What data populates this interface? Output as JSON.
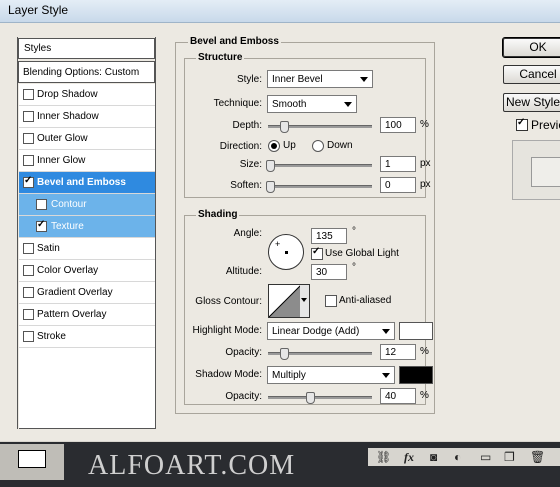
{
  "window": {
    "title": "Layer Style"
  },
  "styles_panel": {
    "header": "Styles",
    "blending": "Blending Options: Custom",
    "items": [
      {
        "label": "Drop Shadow",
        "checked": false
      },
      {
        "label": "Inner Shadow",
        "checked": false
      },
      {
        "label": "Outer Glow",
        "checked": false
      },
      {
        "label": "Inner Glow",
        "checked": false
      },
      {
        "label": "Bevel and Emboss",
        "checked": true
      },
      {
        "label": "Contour",
        "checked": false
      },
      {
        "label": "Texture",
        "checked": true
      },
      {
        "label": "Satin",
        "checked": false
      },
      {
        "label": "Color Overlay",
        "checked": false
      },
      {
        "label": "Gradient Overlay",
        "checked": false
      },
      {
        "label": "Pattern Overlay",
        "checked": false
      },
      {
        "label": "Stroke",
        "checked": false
      }
    ]
  },
  "buttons": {
    "ok": "OK",
    "cancel": "Cancel",
    "new_style": "New Style...",
    "preview": "Preview"
  },
  "bevel": {
    "title": "Bevel and Emboss",
    "structure_title": "Structure",
    "style_label": "Style:",
    "style_value": "Inner Bevel",
    "technique_label": "Technique:",
    "technique_value": "Smooth",
    "depth_label": "Depth:",
    "depth_value": "100",
    "depth_unit": "%",
    "direction_label": "Direction:",
    "direction_up": "Up",
    "direction_down": "Down",
    "size_label": "Size:",
    "size_value": "1",
    "size_unit": "px",
    "soften_label": "Soften:",
    "soften_value": "0",
    "soften_unit": "px"
  },
  "shading": {
    "title": "Shading",
    "angle_label": "Angle:",
    "angle_value": "135",
    "angle_unit": "°",
    "global_light": "Use Global Light",
    "altitude_label": "Altitude:",
    "altitude_value": "30",
    "altitude_unit": "°",
    "gloss_label": "Gloss Contour:",
    "anti_aliased": "Anti-aliased",
    "highlight_label": "Highlight Mode:",
    "highlight_value": "Linear Dodge (Add)",
    "highlight_color": "#ffffff",
    "hl_opacity_label": "Opacity:",
    "hl_opacity_value": "12",
    "hl_opacity_unit": "%",
    "shadow_label": "Shadow Mode:",
    "shadow_value": "Multiply",
    "shadow_color": "#000000",
    "sh_opacity_label": "Opacity:",
    "sh_opacity_value": "40",
    "sh_opacity_unit": "%"
  },
  "watermark": "ALFOART.COM"
}
